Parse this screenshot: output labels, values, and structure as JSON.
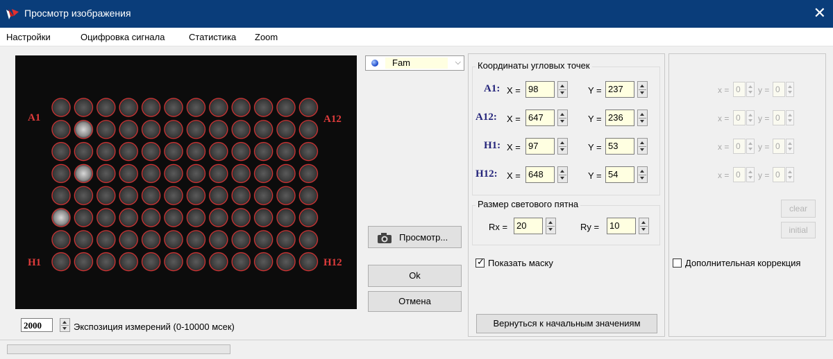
{
  "window": {
    "title": "Просмотр изображения",
    "close_glyph": "✕"
  },
  "menu": [
    "Настройки",
    "Оцифровка сигнала",
    "Статистика",
    "Zoom"
  ],
  "plate": {
    "labels": {
      "a1": "A1",
      "a12": "A12",
      "h1": "H1",
      "h12": "H12"
    },
    "rows": 8,
    "cols": 12,
    "bright_wells": [
      {
        "row": 2,
        "col": 2,
        "level": 0.8
      },
      {
        "row": 4,
        "col": 2,
        "level": 0.75
      },
      {
        "row": 6,
        "col": 1,
        "level": 0.7
      }
    ],
    "mask_color": "#d62f2f"
  },
  "exposure": {
    "value": "2000",
    "label": "Экспозиция измерений (0-10000 мсек)"
  },
  "channel": {
    "selected": "Fam",
    "icon": "blue-dot-icon",
    "chevron": "⌵"
  },
  "buttons": {
    "preview": "Просмотр...",
    "ok": "Ok",
    "cancel": "Отмена",
    "reset": "Вернуться к начальным значениям"
  },
  "corners": {
    "title": "Координаты угловых точек",
    "x_label": "X =",
    "y_label": "Y =",
    "items": [
      {
        "label": "A1:",
        "x": "98",
        "y": "237"
      },
      {
        "label": "A12:",
        "x": "647",
        "y": "236"
      },
      {
        "label": "H1:",
        "x": "97",
        "y": "53"
      },
      {
        "label": "H12:",
        "x": "648",
        "y": "54"
      }
    ]
  },
  "spot": {
    "title": "Размер светового пятна",
    "rx_label": "Rx =",
    "rx": "20",
    "ry_label": "Ry =",
    "ry": "10"
  },
  "mask_checkbox": {
    "label": "Показать маску",
    "checked": true
  },
  "extra": {
    "x_label": "x =",
    "y_label": "y =",
    "rows": [
      {
        "x": "0",
        "y": "0"
      },
      {
        "x": "0",
        "y": "0"
      },
      {
        "x": "0",
        "y": "0"
      },
      {
        "x": "0",
        "y": "0"
      }
    ],
    "clear": "clear",
    "initial": "initial",
    "checkbox_label": "Дополнительная коррекция",
    "checked": false
  }
}
